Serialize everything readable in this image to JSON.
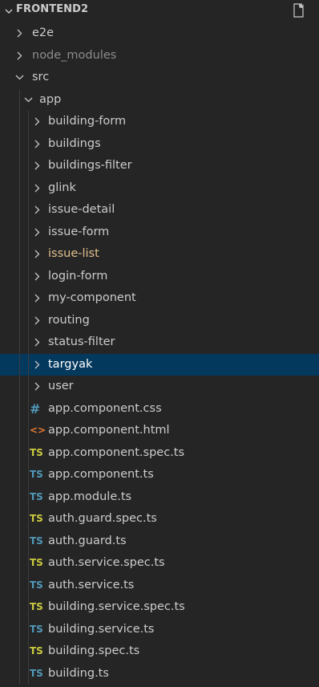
{
  "explorer": {
    "title": "FRONTEND2",
    "new_file_icon": "new-file-icon"
  },
  "tree": [
    {
      "label": "e2e",
      "type": "folder",
      "expanded": false,
      "depth": 0
    },
    {
      "label": "node_modules",
      "type": "folder",
      "expanded": false,
      "depth": 0,
      "dimmed": true
    },
    {
      "label": "src",
      "type": "folder",
      "expanded": true,
      "depth": 0
    },
    {
      "label": "app",
      "type": "folder",
      "expanded": true,
      "depth": 1
    },
    {
      "label": "building-form",
      "type": "folder",
      "expanded": false,
      "depth": 2
    },
    {
      "label": "buildings",
      "type": "folder",
      "expanded": false,
      "depth": 2
    },
    {
      "label": "buildings-filter",
      "type": "folder",
      "expanded": false,
      "depth": 2
    },
    {
      "label": "glink",
      "type": "folder",
      "expanded": false,
      "depth": 2
    },
    {
      "label": "issue-detail",
      "type": "folder",
      "expanded": false,
      "depth": 2
    },
    {
      "label": "issue-form",
      "type": "folder",
      "expanded": false,
      "depth": 2
    },
    {
      "label": "issue-list",
      "type": "folder",
      "expanded": false,
      "depth": 2,
      "modified": true
    },
    {
      "label": "login-form",
      "type": "folder",
      "expanded": false,
      "depth": 2
    },
    {
      "label": "my-component",
      "type": "folder",
      "expanded": false,
      "depth": 2
    },
    {
      "label": "routing",
      "type": "folder",
      "expanded": false,
      "depth": 2
    },
    {
      "label": "status-filter",
      "type": "folder",
      "expanded": false,
      "depth": 2
    },
    {
      "label": "targyak",
      "type": "folder",
      "expanded": false,
      "depth": 2,
      "selected": true
    },
    {
      "label": "user",
      "type": "folder",
      "expanded": false,
      "depth": 2
    },
    {
      "label": "app.component.css",
      "type": "css",
      "icon_text": "#",
      "depth": 2
    },
    {
      "label": "app.component.html",
      "type": "html",
      "icon_text": "<>",
      "depth": 2
    },
    {
      "label": "app.component.spec.ts",
      "type": "ts-spec",
      "icon_text": "TS",
      "depth": 2
    },
    {
      "label": "app.component.ts",
      "type": "ts",
      "icon_text": "TS",
      "depth": 2
    },
    {
      "label": "app.module.ts",
      "type": "ts",
      "icon_text": "TS",
      "depth": 2
    },
    {
      "label": "auth.guard.spec.ts",
      "type": "ts-spec",
      "icon_text": "TS",
      "depth": 2
    },
    {
      "label": "auth.guard.ts",
      "type": "ts",
      "icon_text": "TS",
      "depth": 2
    },
    {
      "label": "auth.service.spec.ts",
      "type": "ts-spec",
      "icon_text": "TS",
      "depth": 2
    },
    {
      "label": "auth.service.ts",
      "type": "ts",
      "icon_text": "TS",
      "depth": 2
    },
    {
      "label": "building.service.spec.ts",
      "type": "ts-spec",
      "icon_text": "TS",
      "depth": 2
    },
    {
      "label": "building.service.ts",
      "type": "ts",
      "icon_text": "TS",
      "depth": 2
    },
    {
      "label": "building.spec.ts",
      "type": "ts-spec",
      "icon_text": "TS",
      "depth": 2
    },
    {
      "label": "building.ts",
      "type": "ts",
      "icon_text": "TS",
      "depth": 2
    }
  ],
  "colors": {
    "background": "#252526",
    "selection": "#04395e",
    "ts_spec": "#cbcb41",
    "ts": "#519aba",
    "html": "#e37933",
    "modified": "#e2c08d"
  }
}
